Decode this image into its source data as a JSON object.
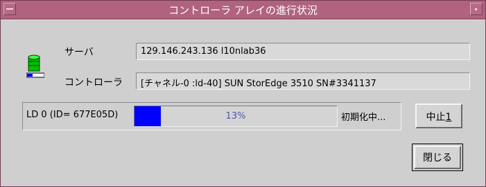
{
  "window": {
    "title": "コントローラ アレイの進行状況"
  },
  "server": {
    "label": "サーバ",
    "value": "129.146.243.136 l10nlab36"
  },
  "controller": {
    "label": "コントローラ",
    "value": "[チャネル-0 :ld-40] SUN StorEdge 3510 SN#3341137"
  },
  "task": {
    "ld_label": "LD 0 (ID= 677E05D)",
    "progress_percent": 13,
    "progress_text": "13%",
    "status": "初期化中..."
  },
  "buttons": {
    "abort_label": "中止",
    "abort_mnemonic": "1",
    "close_label": "閉じる"
  },
  "colors": {
    "titlebar": "#b0627e",
    "progress_fill": "#0000ff",
    "progress_text": "#4e56a8"
  },
  "icons": {
    "window_menu": "window-menu-icon",
    "minimize": "minimize-icon",
    "array": "storage-array-icon"
  }
}
